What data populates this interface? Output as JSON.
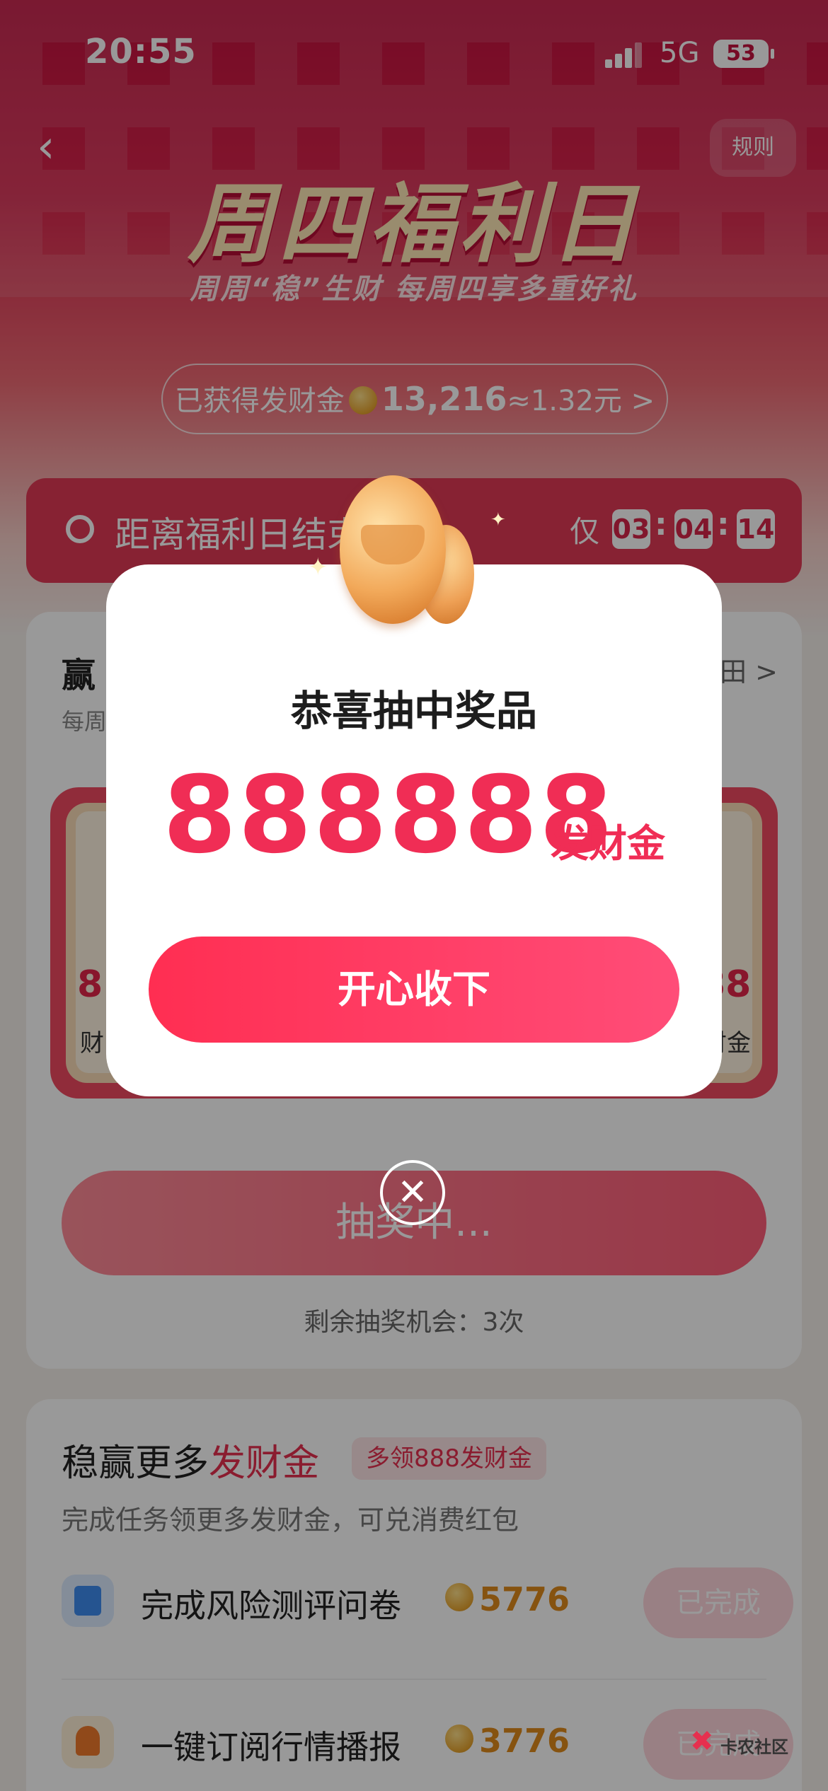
{
  "status": {
    "time": "20:55",
    "network": "5G",
    "battery": "53"
  },
  "header": {
    "rules": "规则",
    "title": "周四福利日",
    "subtitle": "周周“稳”生财 每周四享多重好礼",
    "earned_prefix": "已获得发财金",
    "earned_amount": "13,216",
    "earned_suffix": "≈1.32元 >"
  },
  "countdown": {
    "label": "距离福利日结束",
    "only": "仅",
    "h": "03",
    "m": "04",
    "s": "14"
  },
  "lottery": {
    "title": "赢",
    "subtitle": "每周",
    "link": "田 >",
    "tile_left_num": "8",
    "tile_left_label": "财",
    "tile_right_num": "88",
    "tile_right_label": "财金",
    "draw_button": "抽奖中...",
    "remaining": "剩余抽奖机会：3次"
  },
  "tasks": {
    "title_prefix": "稳赢更多",
    "title_highlight": "发财金",
    "tag": "多领888发财金",
    "subtitle": "完成任务领更多发财金，可兑消费红包",
    "items": [
      {
        "name": "完成风险测评问卷",
        "value": "5776",
        "button": "已完成",
        "icon": "questionnaire-icon"
      },
      {
        "name": "一键订阅行情播报",
        "value": "3776",
        "button": "已完成",
        "icon": "bell-icon"
      }
    ]
  },
  "watermark": "卡农社区",
  "modal": {
    "title": "恭喜抽中奖品",
    "amount": "888888",
    "unit": "发财金",
    "confirm": "开心收下",
    "close": "✕"
  },
  "colors": {
    "brand_red": "#f02d55",
    "coin_gold": "#e08a1c"
  }
}
